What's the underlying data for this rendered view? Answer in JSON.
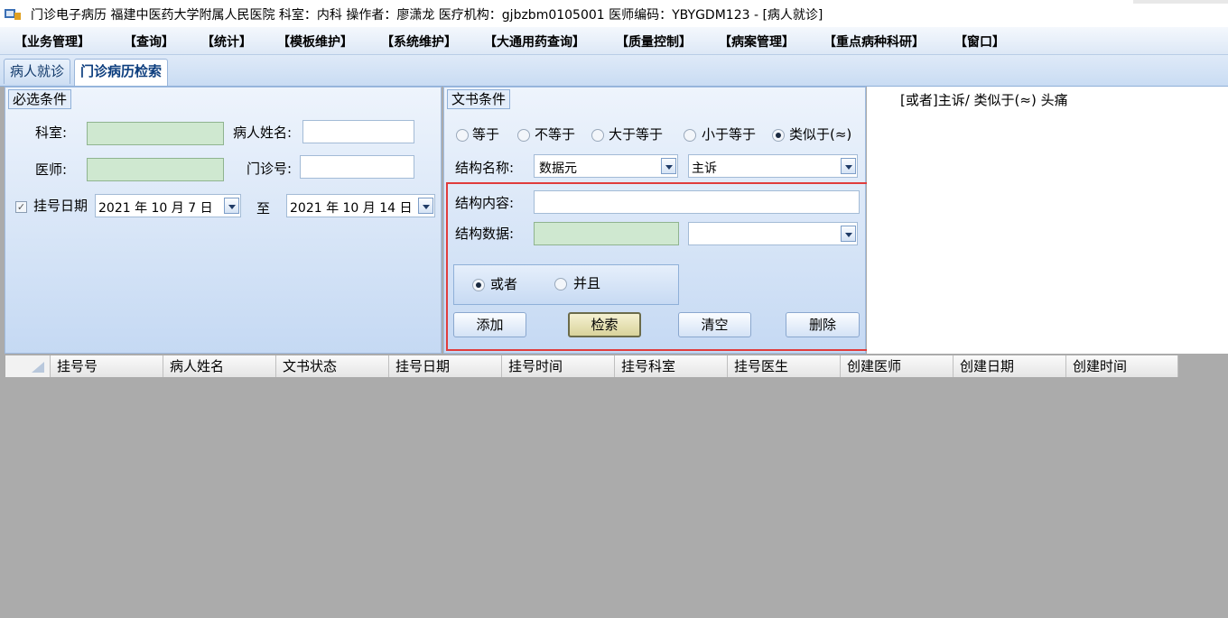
{
  "window": {
    "title": "门诊电子病历 福建中医药大学附属人民医院 科室：内科 操作者：廖潇龙 医疗机构：gjbzbm0105001 医师编码：YBYGDM123 - [病人就诊]"
  },
  "menu": [
    "【业务管理】",
    "【查询】",
    "【统计】",
    "【模板维护】",
    "【系统维护】",
    "【大通用药查询】",
    "【质量控制】",
    "【病案管理】",
    "【重点病种科研】",
    "【窗口】"
  ],
  "tabs": [
    {
      "label": "病人就诊"
    },
    {
      "label": "门诊病历检索"
    }
  ],
  "required": {
    "legend": "必选条件",
    "dept_label": "科室:",
    "dept_value": "",
    "patient_name_label": "病人姓名:",
    "patient_name_value": "",
    "doctor_label": "医师:",
    "doctor_value": "",
    "clinic_no_label": "门诊号:",
    "clinic_no_value": "",
    "reg_date_label": "挂号日期",
    "reg_date_checked": true,
    "date_from": "2021 年 10 月 7 日",
    "to_label": "至",
    "date_to": "2021 年 10 月 14 日"
  },
  "doc": {
    "legend": "文书条件",
    "operators": [
      "等于",
      "不等于",
      "大于等于",
      "小于等于",
      "类似于(≈)"
    ],
    "selected_operator": "类似于(≈)",
    "struct_name_label": "结构名称:",
    "struct_type_value": "数据元",
    "struct_field_value": "主诉",
    "struct_content_label": "结构内容:",
    "struct_content_value": "",
    "struct_data_label": "结构数据:",
    "struct_data_value": "",
    "struct_data_select_value": "",
    "logic_options": [
      "或者",
      "并且"
    ],
    "selected_logic": "或者",
    "buttons": {
      "add": "添加",
      "search": "检索",
      "clear": "清空",
      "delete": "删除"
    }
  },
  "condition_display": "[或者]主诉/ 类似于(≈) 头痛",
  "grid": {
    "columns": [
      "挂号号",
      "病人姓名",
      "文书状态",
      "挂号日期",
      "挂号时间",
      "挂号科室",
      "挂号医生",
      "创建医师",
      "创建日期",
      "创建时间"
    ]
  },
  "colors": {
    "panel_gradient_top": "#eef4fc",
    "panel_gradient_bottom": "#c5d9f3",
    "highlight_border": "#e03c3c",
    "grid_background": "#ababab",
    "required_field_fill": "#cfe8d0"
  }
}
